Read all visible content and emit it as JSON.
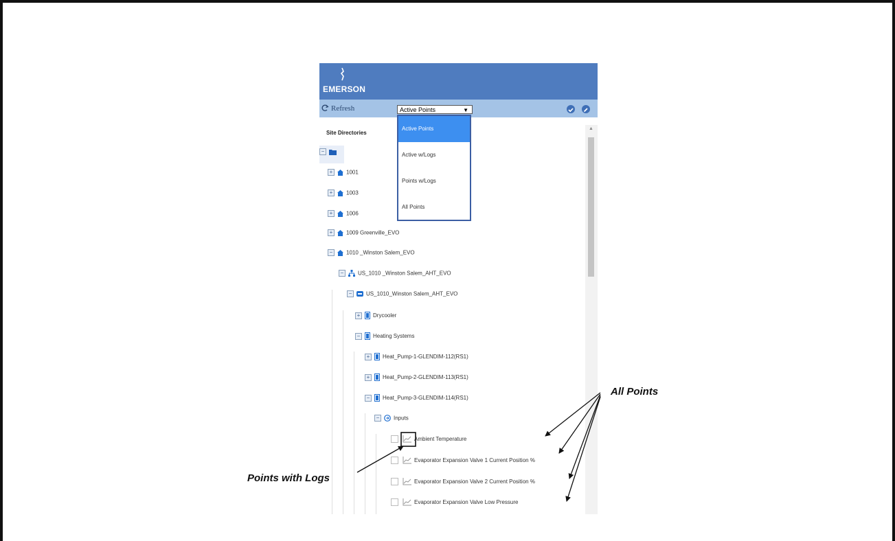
{
  "app": {
    "brand": "EMERSON"
  },
  "toolbar": {
    "refresh_label": "Refresh",
    "filter_value": "Active Points"
  },
  "dropdown": {
    "options": [
      "Active Points",
      "Active w/Logs",
      "Points w/Logs",
      "All Points"
    ],
    "selected": "Active Points"
  },
  "sidebar": {
    "title": "Site Directories"
  },
  "tree": {
    "sites": [
      "1001",
      "1003",
      "1006",
      "1009 Greenville_EVO",
      "1010 _Winston Salem_EVO"
    ],
    "network": "US_1010 _Winston Salem_AHT_EVO",
    "controller": "US_1010_Winston Salem_AHT_EVO",
    "groups": [
      "Drycooler",
      "Heating Systems"
    ],
    "devices": [
      "Heat_Pump-1-GLENDIM-112(RS1)",
      "Heat_Pump-2-GLENDIM-113(RS1)",
      "Heat_Pump-3-GLENDIM-114(RS1)"
    ],
    "inputs_label": "Inputs",
    "points": [
      "Ambient Temperature",
      "Evaporator Expansion Valve 1 Current Position %",
      "Evaporator Expansion Valve 2 Current Position %",
      "Evaporator Expansion Valve Low Pressure"
    ]
  },
  "annotations": {
    "all_points": "All Points",
    "points_with_logs": "Points with Logs"
  },
  "colors": {
    "header": "#4f7cbf",
    "toolbar": "#a4c3e6",
    "selected": "#3d8ff0",
    "node_icon": "#1f6fd1"
  }
}
